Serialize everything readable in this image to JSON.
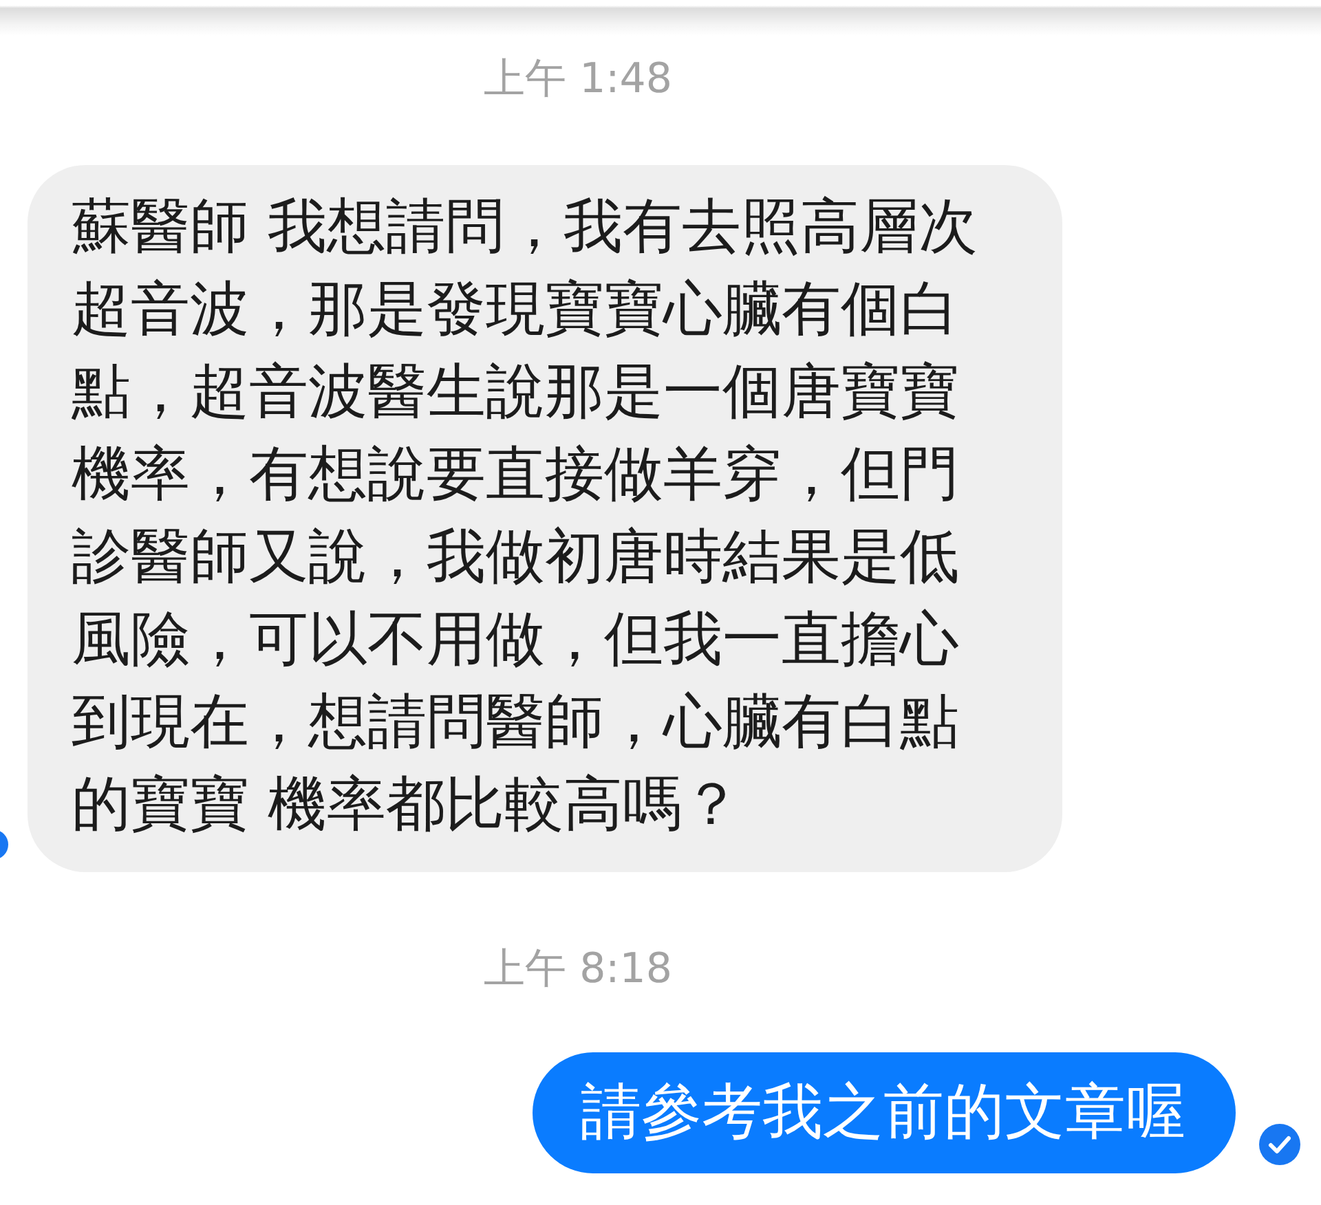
{
  "messages": [
    {
      "kind": "timestamp",
      "text": "上午 1:48"
    },
    {
      "kind": "incoming",
      "text": "蘇醫師 我想請問，我有去照高層次超音波，那是發現寶寶心臟有個白點，超音波醫生說那是一個唐寶寶機率，有想說要直接做羊穿，但門診醫師又說，我做初唐時結果是低風險，可以不用做，但我一直擔心到現在，想請問醫師，心臟有白點的寶寶 機率都比較高嗎？"
    },
    {
      "kind": "timestamp",
      "text": "上午 8:18"
    },
    {
      "kind": "outgoing",
      "text": "請參考我之前的文章喔",
      "delivered": true
    }
  ]
}
